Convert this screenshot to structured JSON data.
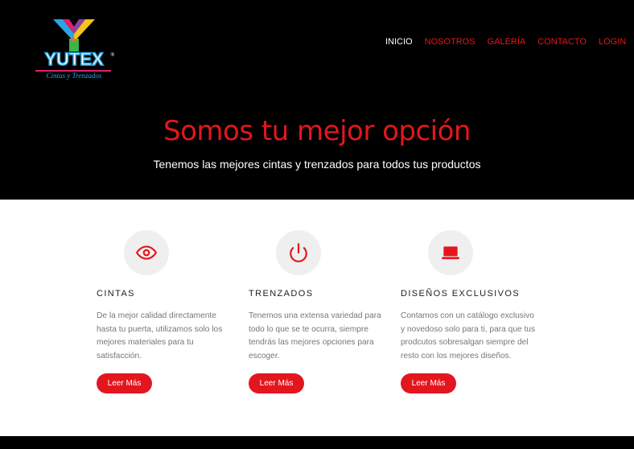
{
  "logo": {
    "word": "YUTEX",
    "reg": "®",
    "tagline": "Cintas y Trenzados",
    "icon": "yutex-y-logo"
  },
  "nav": [
    {
      "label": "INICIO",
      "active": true
    },
    {
      "label": "NOSOTROS",
      "active": false
    },
    {
      "label": "GALERÍA",
      "active": false
    },
    {
      "label": "CONTACTO",
      "active": false
    },
    {
      "label": "LOGIN",
      "active": false
    }
  ],
  "hero": {
    "title": "Somos tu mejor opción",
    "subtitle": "Tenemos las mejores cintas y trenzados para todos tus productos"
  },
  "features": [
    {
      "icon": "eye-icon",
      "title": "CINTAS",
      "text": "De la mejor calidad directamente hasta tu puerta, utilizamos solo los mejores materiales para tu satisfacción.",
      "button": "Leer Más"
    },
    {
      "icon": "power-icon",
      "title": "TRENZADOS",
      "text": "Tenemos una extensa variedad para todo lo que se te ocurra, siempre tendrás las mejores opciones para escoger.",
      "button": "Leer Más"
    },
    {
      "icon": "laptop-icon",
      "title": "DISEÑOS EXCLUSIVOS",
      "text": "Contamos con un catálogo exclusivo y novedoso solo para ti, para que tus prodcutos sobresalgan siempre del resto con los mejores diseños.",
      "button": "Leer Más"
    }
  ],
  "colors": {
    "accent": "#e3161e",
    "header_bg": "#000000",
    "icon_bg": "#efefef",
    "logo_blue": "#2aa6e0",
    "logo_pink": "#e61d6e"
  }
}
